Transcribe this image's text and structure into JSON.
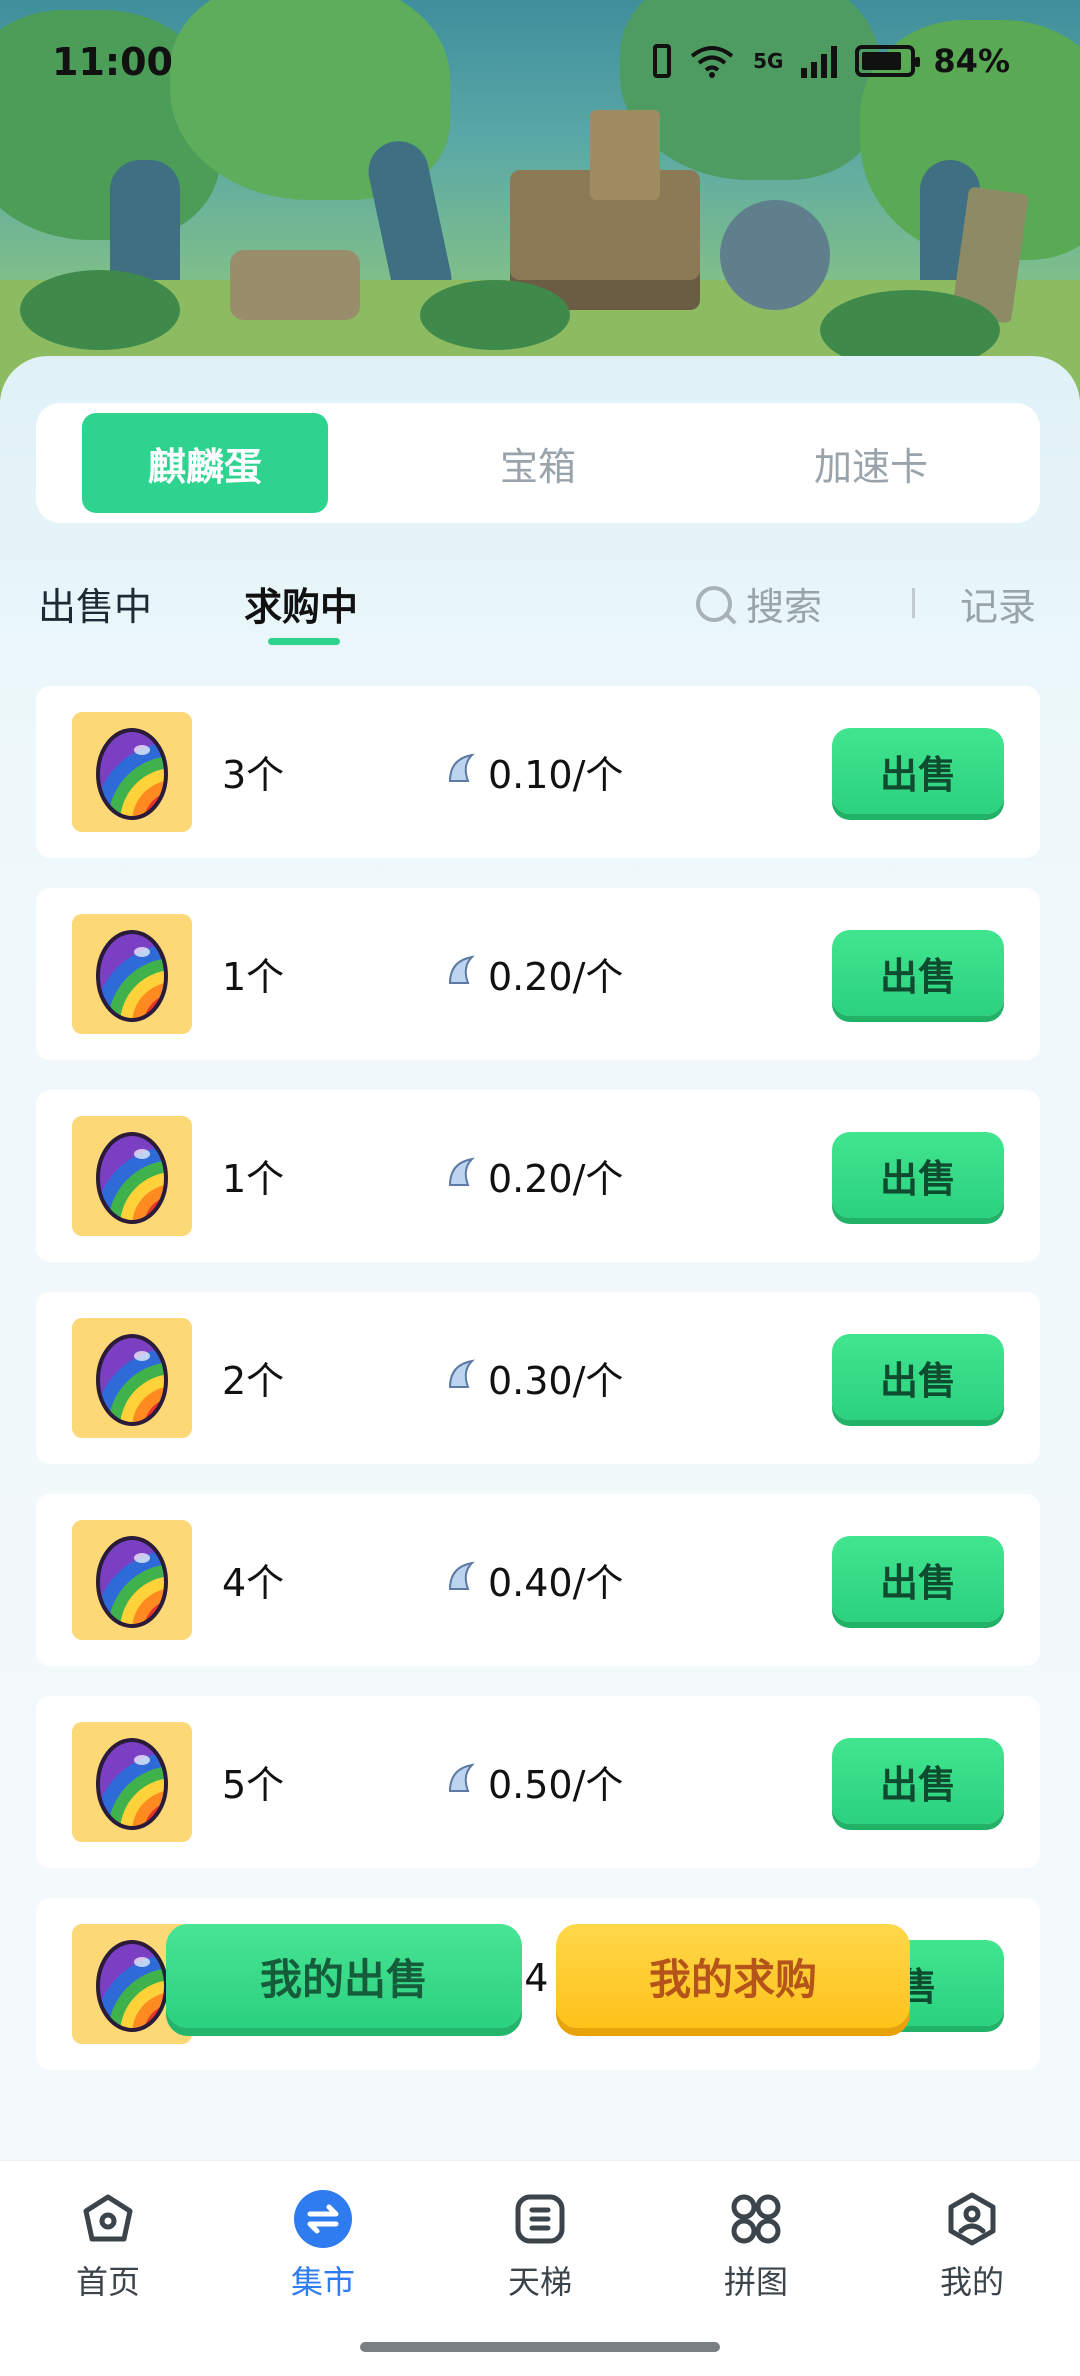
{
  "status_bar": {
    "time": "11:00",
    "network": "5G",
    "battery": "84%"
  },
  "category_tabs": [
    {
      "label": "麒麟蛋",
      "active": true
    },
    {
      "label": "宝箱",
      "active": false
    },
    {
      "label": "加速卡",
      "active": false
    }
  ],
  "sub_tabs": [
    {
      "label": "出售中",
      "active": false
    },
    {
      "label": "求购中",
      "active": true
    }
  ],
  "search": {
    "label": "搜索"
  },
  "records": {
    "label": "记录"
  },
  "listings": [
    {
      "quantity": "3个",
      "price": "0.10/个",
      "action": "出售"
    },
    {
      "quantity": "1个",
      "price": "0.20/个",
      "action": "出售"
    },
    {
      "quantity": "1个",
      "price": "0.20/个",
      "action": "出售"
    },
    {
      "quantity": "2个",
      "price": "0.30/个",
      "action": "出售"
    },
    {
      "quantity": "4个",
      "price": "0.40/个",
      "action": "出售"
    },
    {
      "quantity": "5个",
      "price": "0.50/个",
      "action": "出售"
    },
    {
      "quantity": "",
      "price": ".74",
      "action": "售"
    }
  ],
  "floating_buttons": {
    "my_sell": "我的出售",
    "my_buy": "我的求购"
  },
  "bottom_nav": [
    {
      "label": "首页",
      "icon": "home-icon",
      "active": false
    },
    {
      "label": "集市",
      "icon": "market-exchange-icon",
      "active": true
    },
    {
      "label": "天梯",
      "icon": "ladder-icon",
      "active": false
    },
    {
      "label": "拼图",
      "icon": "puzzle-grid-icon",
      "active": false
    },
    {
      "label": "我的",
      "icon": "profile-icon",
      "active": false
    }
  ],
  "colors": {
    "accent_green": "#2ed38f",
    "active_nav_blue": "#2f7bf0",
    "buy_yellow": "#ffc21a",
    "egg_tile_bg": "#fdd877"
  }
}
